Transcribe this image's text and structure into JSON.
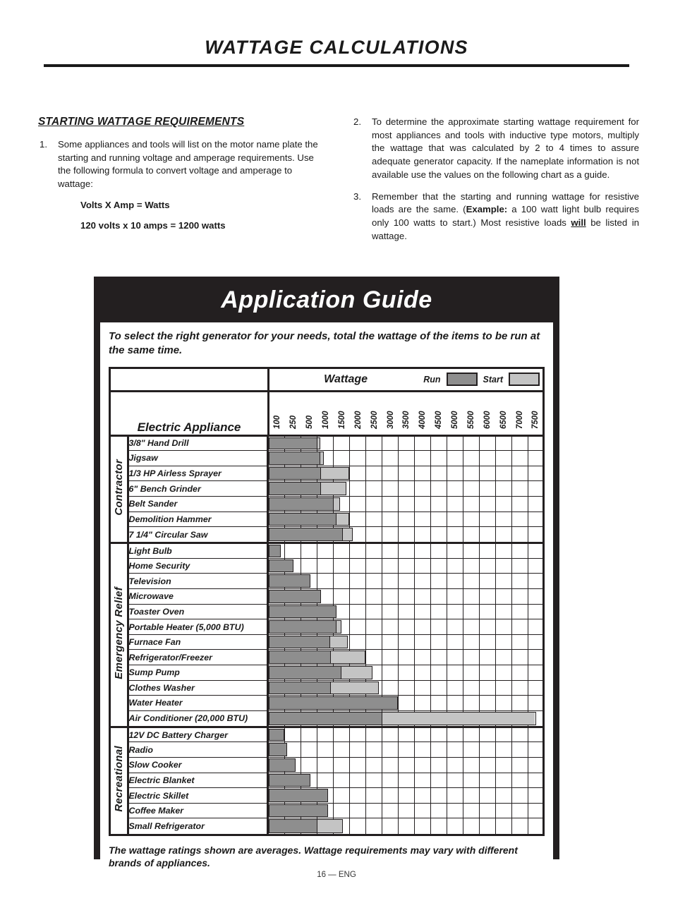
{
  "document": {
    "header_title": "WATTAGE CALCULATIONS",
    "footer": "16  —  ENG"
  },
  "left_column": {
    "section_heading": "STARTING WATTAGE REQUIREMENTS",
    "items": [
      {
        "num": "1.",
        "text": "Some appliances and tools will list on the motor name plate the starting and running voltage and amperage requirements. Use the following formula to convert voltage and amperage to wattage:"
      }
    ],
    "formulas": [
      "Volts X Amp = Watts",
      "120 volts x 10 amps = 1200 watts"
    ]
  },
  "right_column": {
    "items": [
      {
        "num": "2.",
        "text": "To determine the approximate starting wattage requirement for most appliances and tools with inductive type motors, multiply the wattage that was calculated by 2 to 4 times to assure adequate generator capacity. If the nameplate information is not available use the values on the following chart as a guide."
      },
      {
        "num": "3.",
        "text_parts": {
          "a": "Remember that the starting and running wattage for resistive loads are the same. (",
          "example_label": "Example:",
          "b": " a 100 watt light bulb requires only 100 watts to start.)  Most resistive loads ",
          "will": "will",
          "c": " be listed in wattage."
        }
      }
    ]
  },
  "guide": {
    "title": "Application Guide",
    "subtitle": "To select the right generator for your needs, total the wattage of the items to be run at the same time.",
    "footnote": "The wattage ratings shown are averages. Wattage requirements may vary with different brands of appliances.",
    "legend": {
      "wattage_label": "Wattage",
      "run_label": "Run",
      "start_label": "Start",
      "run_color": "#8e8e8e",
      "start_color": "#c4c4c4"
    },
    "appliance_header": "Electric Appliance"
  },
  "chart_data": {
    "type": "bar",
    "title": "Application Guide",
    "subtitle": "To select the right generator for your needs, total the wattage of the items to be run at the same time.",
    "xlabel": "Wattage",
    "ylabel": "Electric Appliance",
    "orientation": "horizontal",
    "stacked": true,
    "grid": true,
    "legend": [
      {
        "name": "Run",
        "color": "#8e8e8e"
      },
      {
        "name": "Start",
        "color": "#c4c4c4"
      }
    ],
    "axis_ticks": [
      100,
      250,
      500,
      1000,
      1500,
      2000,
      2500,
      3000,
      3500,
      4000,
      4500,
      5000,
      5500,
      6000,
      6500,
      7000,
      7500
    ],
    "axis_note": "Non-linear axis: 17 equal-width columns labeled 100, 250, 500, then 1000..7500 in steps of 500",
    "xlim": [
      0,
      7500
    ],
    "groups": [
      {
        "name": "Contractor",
        "rows": [
          {
            "label": "3/8\" Hand Drill",
            "run": 500,
            "start": 600
          },
          {
            "label": "Jigsaw",
            "run": 600,
            "start": 700
          },
          {
            "label": "1/3 HP Airless Sprayer",
            "run": 600,
            "start": 1500
          },
          {
            "label": "6\" Bench Grinder",
            "run": 600,
            "start": 1400
          },
          {
            "label": "Belt Sander",
            "run": 1000,
            "start": 1200
          },
          {
            "label": "Demolition Hammer",
            "run": 1100,
            "start": 1500
          },
          {
            "label": "7 1/4\" Circular Saw",
            "run": 1300,
            "start": 1600
          }
        ]
      },
      {
        "name": "Emergency Relief",
        "rows": [
          {
            "label": "Light Bulb",
            "run": 75,
            "start": 75
          },
          {
            "label": "Home Security",
            "run": 180,
            "start": 180
          },
          {
            "label": "Television",
            "run": 400,
            "start": 400
          },
          {
            "label": "Microwave",
            "run": 625,
            "start": 625
          },
          {
            "label": "Toaster Oven",
            "run": 1100,
            "start": 1100
          },
          {
            "label": "Portable Heater (5,000 BTU)",
            "run": 1100,
            "start": 1250
          },
          {
            "label": "Furnace Fan",
            "run": 900,
            "start": 1450
          },
          {
            "label": "Refrigerator/Freezer",
            "run": 900,
            "start": 2000
          },
          {
            "label": "Sump Pump",
            "run": 1250,
            "start": 2200
          },
          {
            "label": "Clothes Washer",
            "run": 900,
            "start": 2400
          },
          {
            "label": "Water Heater",
            "run": 3000,
            "start": 3000
          },
          {
            "label": "Air Conditioner (20,000 BTU)",
            "run": 2500,
            "start": 7250
          }
        ]
      },
      {
        "name": "Recreational",
        "rows": [
          {
            "label": "12V DC Battery Charger",
            "run": 100,
            "start": 100
          },
          {
            "label": "Radio",
            "run": 125,
            "start": 125
          },
          {
            "label": "Slow Cooker",
            "run": 200,
            "start": 200
          },
          {
            "label": "Electric Blanket",
            "run": 400,
            "start": 400
          },
          {
            "label": "Electric Skillet",
            "run": 850,
            "start": 850
          },
          {
            "label": "Coffee Maker",
            "run": 850,
            "start": 850
          },
          {
            "label": "Small Refrigerator",
            "run": 500,
            "start": 1300
          }
        ]
      }
    ]
  }
}
